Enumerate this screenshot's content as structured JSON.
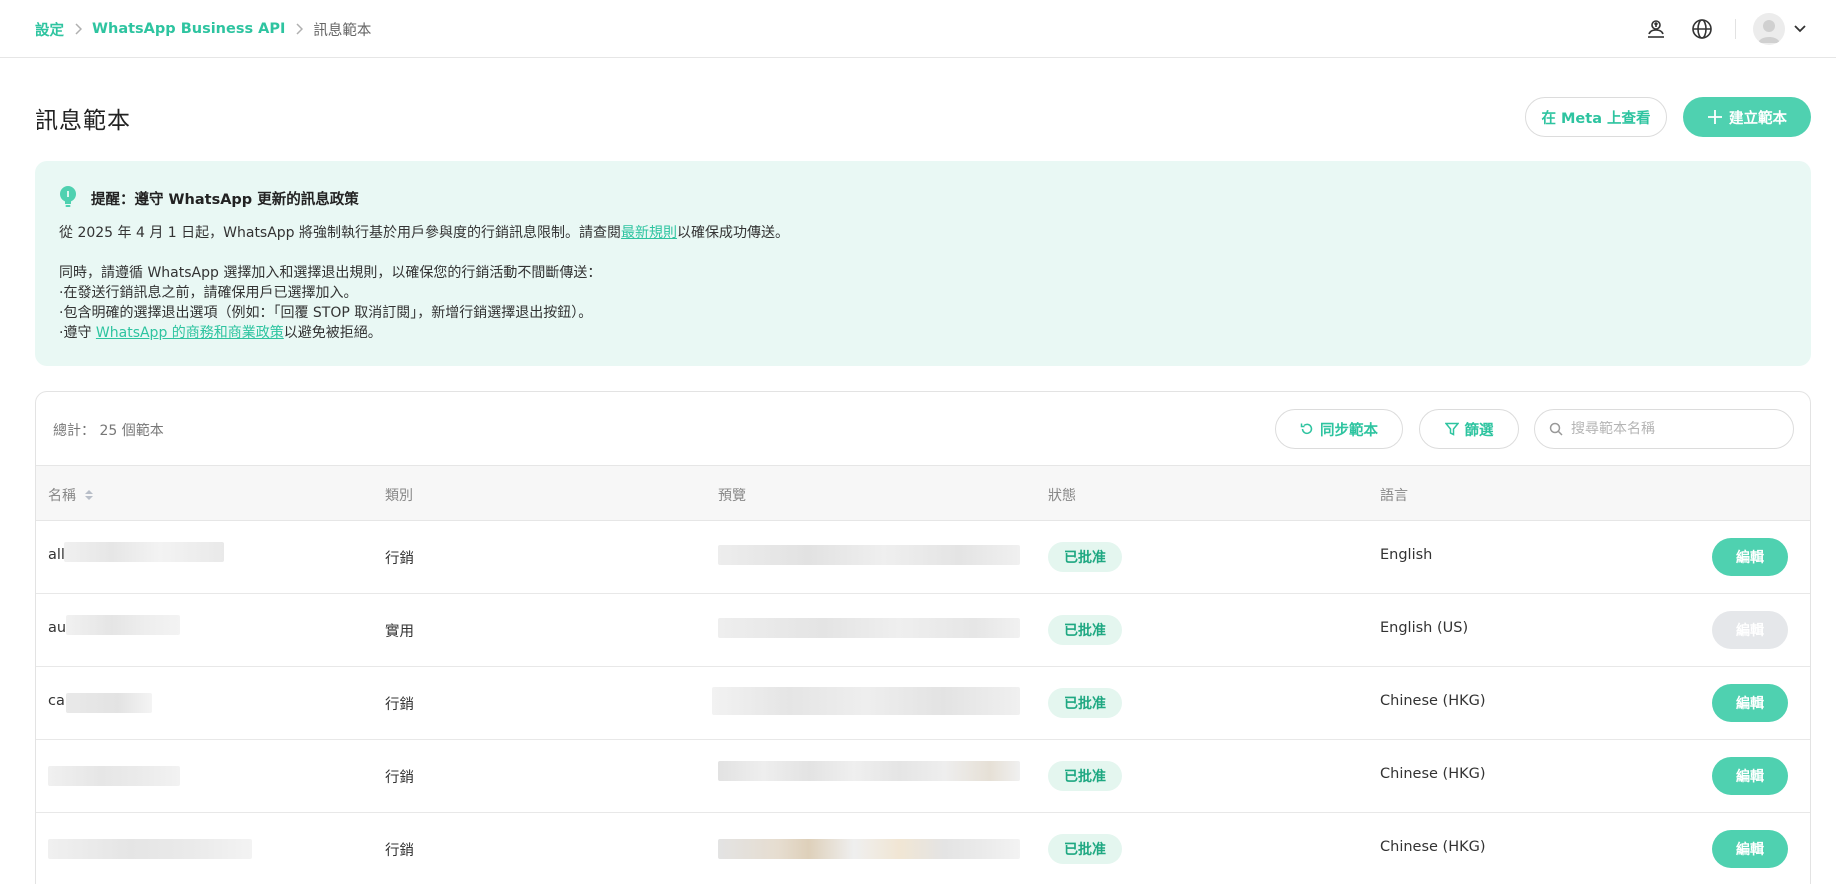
{
  "breadcrumb": {
    "items": [
      "設定",
      "WhatsApp Business API"
    ],
    "current": "訊息範本"
  },
  "header_icons": [
    "user-upload-icon",
    "globe-icon",
    "avatar",
    "chevron-down-icon"
  ],
  "page": {
    "title": "訊息範本",
    "view_on_meta_label": "在 Meta 上查看",
    "create_template_label": "建立範本"
  },
  "notice": {
    "title": "提醒：遵守 WhatsApp 更新的訊息政策",
    "line1_before": "從 2025 年 4 月 1 日起，WhatsApp 將強制執行基於用戶參與度的行銷訊息限制。請查閱",
    "line1_link": "最新規則",
    "line1_after": "以確保成功傳送。",
    "line2": "同時，請遵循 WhatsApp 選擇加入和選擇退出規則，以確保您的行銷活動不間斷傳送：",
    "line3": "·在發送行銷訊息之前，請確保用戶已選擇加入。",
    "line4": "·包含明確的選擇退出選項（例如：「回覆 STOP 取消訂閱」，新增行銷選擇退出按鈕）。",
    "line5_before": "·遵守 ",
    "line5_link": "WhatsApp 的商務和商業政策",
    "line5_after": "以避免被拒絕。"
  },
  "table_toolbar": {
    "total_label": "總計： 25 個範本",
    "sync_label": "同步範本",
    "filter_label": "篩選",
    "search_placeholder": "搜尋範本名稱"
  },
  "table": {
    "columns": [
      "名稱",
      "類別",
      "預覽",
      "狀態",
      "語言"
    ],
    "rows": [
      {
        "name": "all",
        "category": "行銷",
        "status": "已批准",
        "language": "English",
        "edit": "編輯",
        "edit_enabled": true
      },
      {
        "name": "au",
        "category": "實用",
        "status": "已批准",
        "language": "English (US)",
        "edit": "編輯",
        "edit_enabled": false
      },
      {
        "name": "ca",
        "category": "行銷",
        "status": "已批准",
        "language": "Chinese (HKG)",
        "edit": "編輯",
        "edit_enabled": true
      },
      {
        "name": "",
        "category": "行銷",
        "status": "已批准",
        "language": "Chinese (HKG)",
        "edit": "編輯",
        "edit_enabled": true
      },
      {
        "name": "",
        "category": "行銷",
        "status": "已批准",
        "language": "Chinese (HKG)",
        "edit": "編輯",
        "edit_enabled": true
      }
    ]
  },
  "colors": {
    "accent": "#2ec4a0",
    "primary_button": "#4fd1b0",
    "notice_bg": "#e9f8f4",
    "status_bg": "#e4f6ef",
    "disabled_button": "#e5e7ea"
  }
}
